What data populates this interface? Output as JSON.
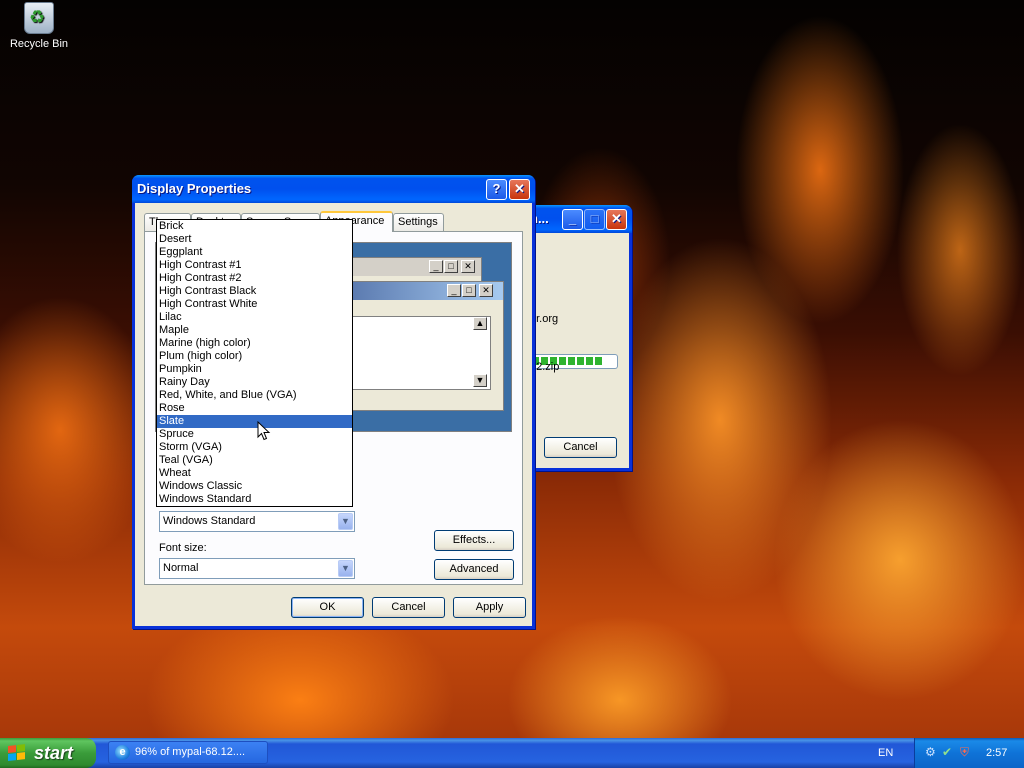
{
  "desktop": {
    "recycle_bin_label": "Recycle Bin"
  },
  "download_dialog": {
    "title_fragment": "n...",
    "url_fragment": "er.org",
    "file_fragment": "82.zip",
    "cancel_label": "Cancel",
    "progress_percent": 96
  },
  "display_properties": {
    "title": "Display Properties",
    "tabs": [
      {
        "label": "Themes"
      },
      {
        "label": "Desktop"
      },
      {
        "label": "Screen Saver"
      },
      {
        "label": "Appearance"
      },
      {
        "label": "Settings"
      }
    ],
    "active_tab": "Appearance",
    "color_scheme": {
      "selected_value": "Windows Standard",
      "highlighted_option": "Slate",
      "options": [
        "Brick",
        "Desert",
        "Eggplant",
        "High Contrast #1",
        "High Contrast #2",
        "High Contrast Black",
        "High Contrast White",
        "Lilac",
        "Maple",
        "Marine (high color)",
        "Plum (high color)",
        "Pumpkin",
        "Rainy Day",
        "Red, White, and Blue (VGA)",
        "Rose",
        "Slate",
        "Spruce",
        "Storm (VGA)",
        "Teal (VGA)",
        "Wheat",
        "Windows Classic",
        "Windows Standard"
      ]
    },
    "font_size": {
      "label": "Font size:",
      "value": "Normal"
    },
    "effects_label": "Effects...",
    "advanced_label": "Advanced",
    "ok_label": "OK",
    "cancel_label": "Cancel",
    "apply_label": "Apply"
  },
  "taskbar": {
    "start_label": "start",
    "task_label": "96% of mypal-68.12....",
    "language": "EN",
    "clock": "2:57"
  }
}
